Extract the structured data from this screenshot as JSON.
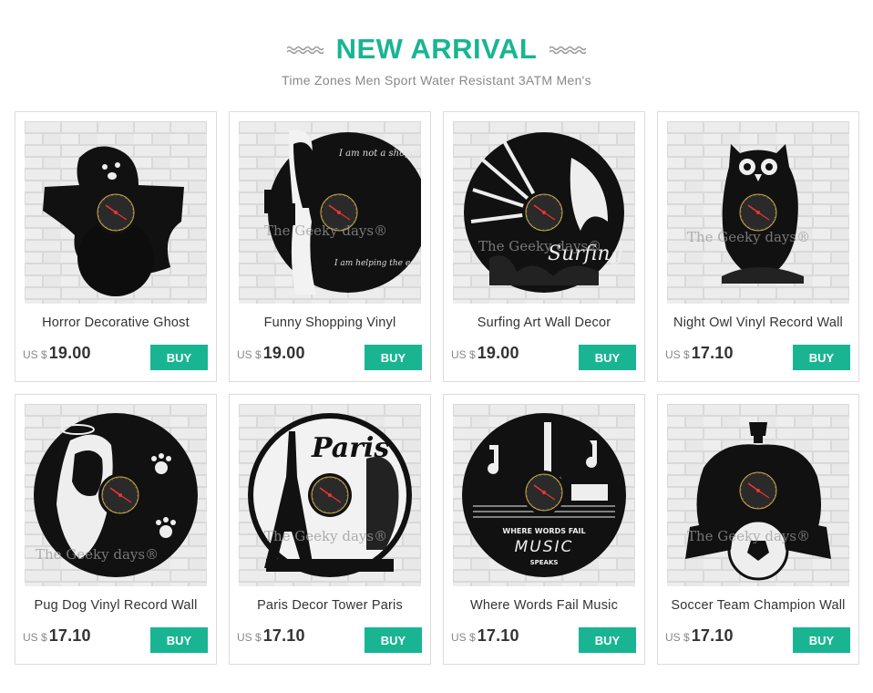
{
  "header": {
    "title": "NEW ARRIVAL",
    "subtitle": "Time Zones Men Sport Water Resistant 3ATM Men's",
    "accent_color": "#19b593"
  },
  "products": [
    {
      "name": "Horror  Decorative Ghost",
      "currency": "US $",
      "price": "19.00",
      "buy_label": "BUY",
      "image_icon": "ghost-clock-icon",
      "watermark": ""
    },
    {
      "name": "Funny Shopping Vinyl",
      "currency": "US $",
      "price": "19.00",
      "buy_label": "BUY",
      "image_icon": "shopping-woman-clock-icon",
      "watermark": "The Geeky days®"
    },
    {
      "name": "Surfing  Art Wall Decor",
      "currency": "US $",
      "price": "19.00",
      "buy_label": "BUY",
      "image_icon": "surfing-clock-icon",
      "watermark": "The Geeky days®"
    },
    {
      "name": "Night Owl Vinyl Record Wall",
      "currency": "US $",
      "price": "17.10",
      "buy_label": "BUY",
      "image_icon": "owl-clock-icon",
      "watermark": "The Geeky days®"
    },
    {
      "name": "Pug Dog Vinyl Record Wall",
      "currency": "US $",
      "price": "17.10",
      "buy_label": "BUY",
      "image_icon": "pug-dog-clock-icon",
      "watermark": "The Geeky days®"
    },
    {
      "name": "Paris Decor Tower Paris",
      "currency": "US $",
      "price": "17.10",
      "buy_label": "BUY",
      "image_icon": "paris-clock-icon",
      "watermark": "The Geeky days®"
    },
    {
      "name": "Where Words Fail Music",
      "currency": "US $",
      "price": "17.10",
      "buy_label": "BUY",
      "image_icon": "music-clock-icon",
      "watermark": ""
    },
    {
      "name": "Soccer  Team Champion Wall",
      "currency": "US $",
      "price": "17.10",
      "buy_label": "BUY",
      "image_icon": "soccer-clock-icon",
      "watermark": "The Geeky days®"
    }
  ],
  "image_text": {
    "shopping_top": "I am not a shopaholic",
    "shopping_bottom": "I am helping the economy",
    "surfing_word": "Surfing",
    "paris_word": "Paris",
    "music_line1": "WHERE WORDS FAIL",
    "music_line2": "MUSIC",
    "music_line3": "SPEAKS"
  }
}
